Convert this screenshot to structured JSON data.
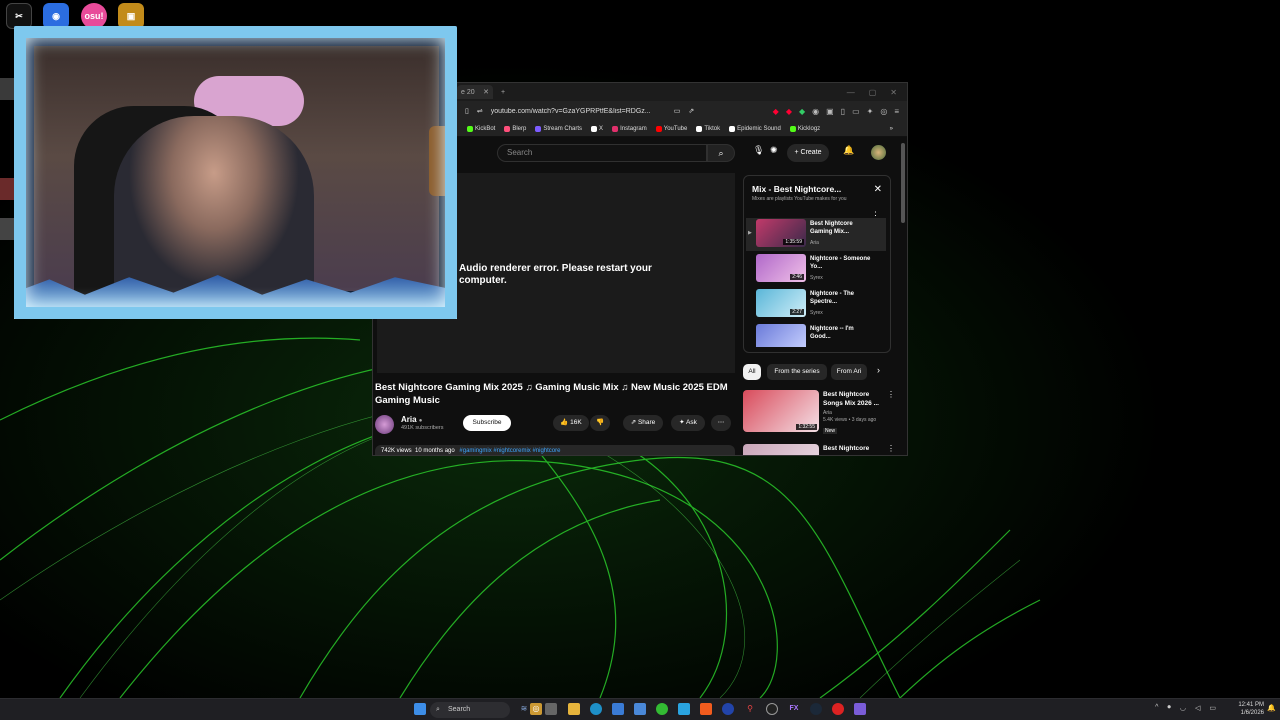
{
  "desktop": {
    "icons": [
      {
        "name": "CapCut",
        "color": "#111111",
        "glyph": "✂"
      },
      {
        "name": "App",
        "color": "#2b6de0",
        "glyph": "◉"
      },
      {
        "name": "osu!",
        "color": "#e84b9a",
        "glyph": "osu!"
      },
      {
        "name": "OBS",
        "color": "#c28b1a",
        "glyph": "▣"
      }
    ]
  },
  "browser": {
    "tab_label": "e 20",
    "tab_close": "✕",
    "new_tab": "+",
    "url": "youtube.com/watch?v=GzaYGPRPtfE&list=RDGz...",
    "bookmarks": [
      {
        "label": "KickBot",
        "color": "#53fc18"
      },
      {
        "label": "Blerp",
        "color": "#ff4f7b"
      },
      {
        "label": "Stream Charts",
        "color": "#7d5cff"
      },
      {
        "label": "X",
        "color": "#ffffff"
      },
      {
        "label": "Instagram",
        "color": "#e1306c"
      },
      {
        "label": "YouTube",
        "color": "#ff0000"
      },
      {
        "label": "Tiktok",
        "color": "#ffffff"
      },
      {
        "label": "Epidemic Sound",
        "color": "#ffffff"
      },
      {
        "label": "Kicklogz",
        "color": "#53fc18"
      }
    ],
    "more_bookmarks": "»"
  },
  "youtube": {
    "search_placeholder": "Search",
    "create_label": "Create",
    "player_error": "Audio renderer error. Please restart your computer.",
    "video_title": "Best Nightcore Gaming Mix 2025 ♫ Gaming Music Mix ♫ New Music 2025 EDM Gaming Music",
    "channel_name": "Aria",
    "channel_subs": "491K subscribers",
    "subscribe_label": "Subscribe",
    "like_count": "16K",
    "share_label": "Share",
    "ask_label": "Ask",
    "views": "742K views",
    "age": "10 months ago",
    "tags": "#gamingmix #nightcoremix #nightcore",
    "mix": {
      "title": "Mix - Best Nightcore...",
      "subtitle": "Mixes are playlists YouTube makes for you",
      "items": [
        {
          "title": "Best Nightcore Gaming Mix...",
          "artist": "Aria",
          "duration": "1:35:59",
          "color": "#c23a6a"
        },
        {
          "title": "Nightcore - Someone Yo...",
          "artist": "Syrex",
          "duration": "2:46",
          "color": "#b068c9"
        },
        {
          "title": "Nightcore - The Spectre...",
          "artist": "Syrex",
          "duration": "2:27",
          "color": "#5ab6d8"
        },
        {
          "title": "Nightcore -- I'm Good...",
          "artist": "",
          "duration": "",
          "color": "#6a7ad9"
        }
      ]
    },
    "chips": [
      "All",
      "From the series",
      "From Ari"
    ],
    "recs": [
      {
        "title": "Best Nightcore Songs Mix 2026 ...",
        "channel": "Aria",
        "info": "5.4K views • 3 days ago",
        "badge": "New",
        "duration": "1:32:55",
        "color": "#d94b5b"
      },
      {
        "title": "Best Nightcore",
        "channel": "",
        "info": "",
        "badge": "",
        "duration": "",
        "color": "#c9a5b8"
      }
    ]
  },
  "taskbar": {
    "search_label": "Search",
    "time": "12:41 PM",
    "date": "1/6/2026"
  }
}
